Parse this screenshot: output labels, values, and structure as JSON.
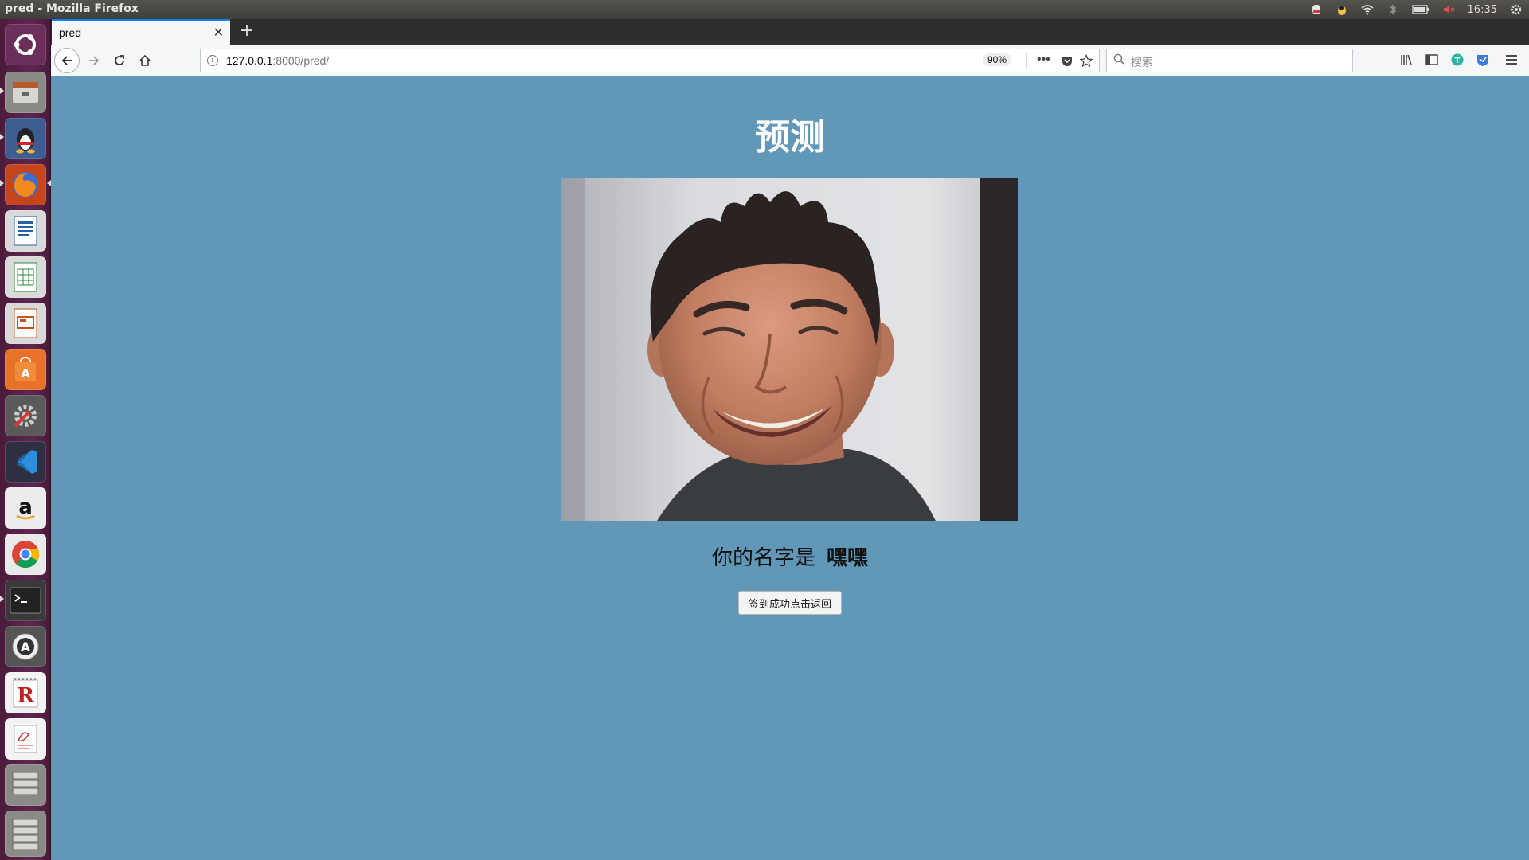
{
  "system": {
    "window_title": "pred - Mozilla Firefox",
    "clock": "16:35"
  },
  "launcher": {
    "apps": [
      "ubuntu-dash",
      "files",
      "qq",
      "firefox",
      "writer",
      "calc",
      "impress",
      "software-center",
      "system-settings",
      "vscode",
      "amazon",
      "chrome",
      "terminal",
      "software-updater",
      "rstudio",
      "text-editor",
      "workspaces"
    ]
  },
  "browser": {
    "tab_title": "pred",
    "url_host": "127.0.0.1",
    "url_rest": ":8000/pred/",
    "zoom": "90%",
    "search_placeholder": "搜索"
  },
  "page": {
    "heading": "预测",
    "result_prefix": "你的名字是",
    "result_name": "嘿嘿",
    "button_label": "签到成功点击返回"
  }
}
